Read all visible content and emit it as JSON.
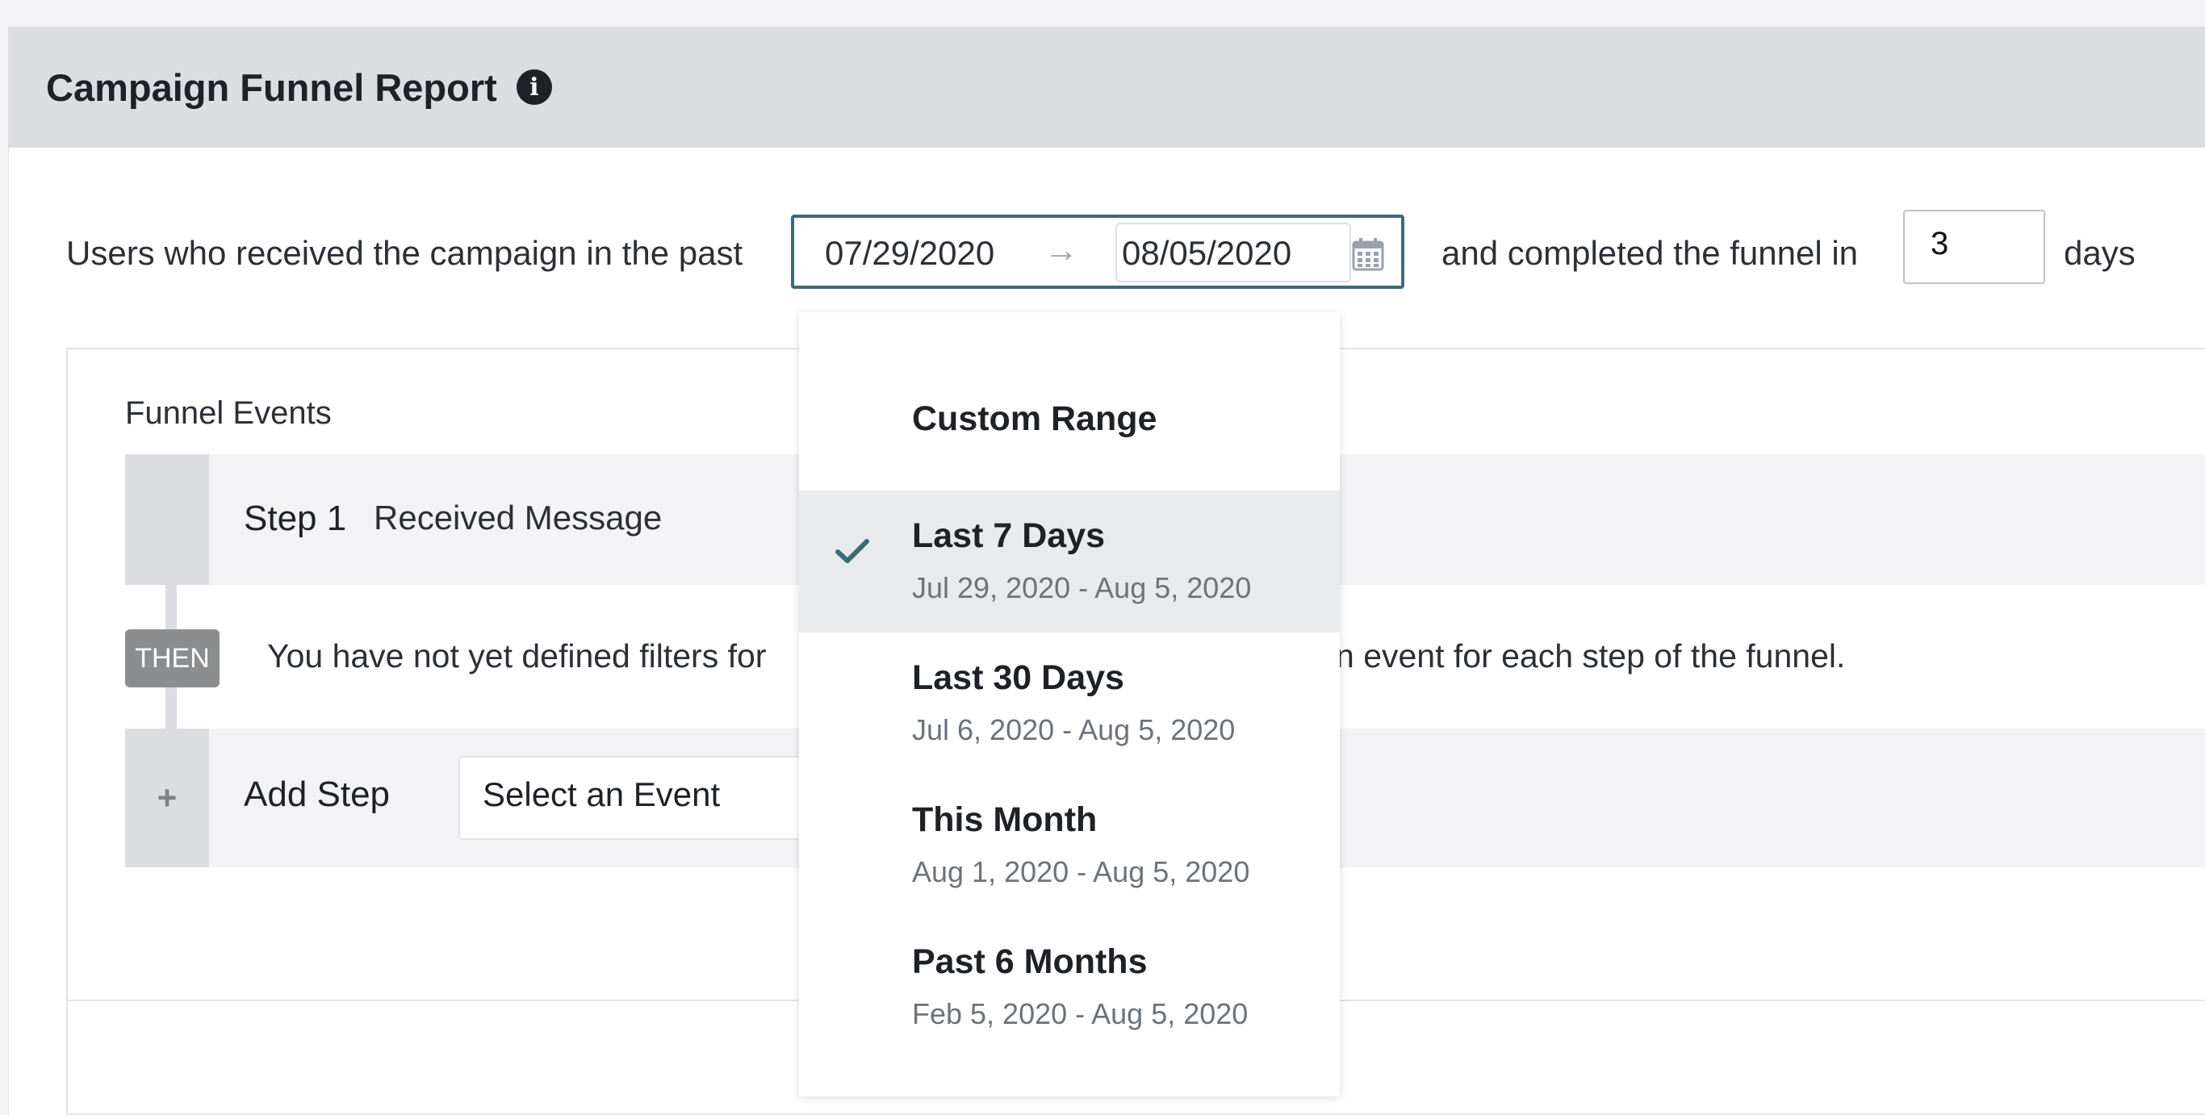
{
  "report": {
    "title": "Campaign Funnel Report",
    "info_icon": "info-icon"
  },
  "filter": {
    "prefix": "Users who received the campaign in the past",
    "start_date": "07/29/2020",
    "end_date": "08/05/2020",
    "arrow_icon": "arrow-right-icon",
    "calendar_icon": "calendar-icon",
    "middle": "and completed the funnel in",
    "days_value": "3",
    "suffix": "days"
  },
  "funnel": {
    "label": "Funnel Events",
    "step": {
      "number": "Step 1",
      "event": "Received Message"
    },
    "then_badge": "THEN",
    "notice_left": "You have not yet defined filters for",
    "notice_right": "n event for each step of the funnel.",
    "add_step": {
      "label": "Add Step",
      "icon": "+",
      "select_placeholder": "Select an Event"
    }
  },
  "date_dropdown": {
    "items": [
      {
        "title": "Custom Range",
        "subtitle": "",
        "selected": false
      },
      {
        "title": "Last 7 Days",
        "subtitle": "Jul 29, 2020 - Aug 5, 2020",
        "selected": true
      },
      {
        "title": "Last 30 Days",
        "subtitle": "Jul 6, 2020 - Aug 5, 2020",
        "selected": false
      },
      {
        "title": "This Month",
        "subtitle": "Aug 1, 2020 - Aug 5, 2020",
        "selected": false
      },
      {
        "title": "Past 6 Months",
        "subtitle": "Feb 5, 2020 - Aug 5, 2020",
        "selected": false
      }
    ]
  },
  "colors": {
    "accent": "#3d6b78",
    "header_bg": "#dcdde0",
    "selected_bg": "#e9eaec"
  }
}
